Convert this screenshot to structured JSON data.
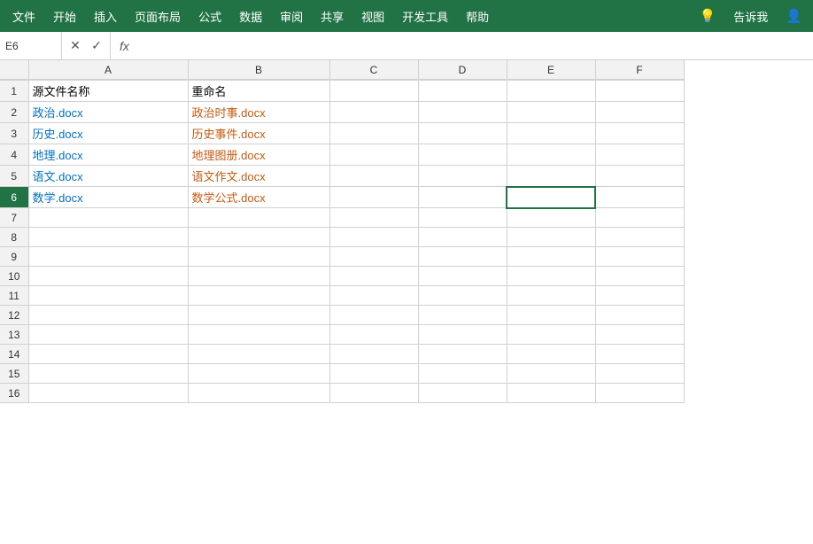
{
  "ribbon": {
    "items": [
      {
        "label": "文件",
        "name": "file"
      },
      {
        "label": "开始",
        "name": "home"
      },
      {
        "label": "插入",
        "name": "insert"
      },
      {
        "label": "页面布局",
        "name": "page-layout"
      },
      {
        "label": "公式",
        "name": "formulas"
      },
      {
        "label": "数据",
        "name": "data"
      },
      {
        "label": "审阅",
        "name": "review"
      },
      {
        "label": "共享",
        "name": "share"
      },
      {
        "label": "视图",
        "name": "view"
      },
      {
        "label": "开发工具",
        "name": "developer"
      },
      {
        "label": "帮助",
        "name": "help"
      }
    ],
    "right_items": [
      {
        "label": "告诉我",
        "name": "tell-me"
      }
    ]
  },
  "formula_bar": {
    "cell_ref": "E6",
    "cancel_label": "✕",
    "confirm_label": "✓",
    "fx_label": "fx"
  },
  "spreadsheet": {
    "col_headers": [
      "A",
      "B",
      "C",
      "D",
      "E",
      "F"
    ],
    "rows": [
      {
        "row_num": "1",
        "cells": [
          {
            "value": "源文件名称",
            "style": "header"
          },
          {
            "value": "重命名",
            "style": "header"
          },
          "",
          "",
          "",
          ""
        ]
      },
      {
        "row_num": "2",
        "cells": [
          {
            "value": "政治.docx",
            "style": "blue"
          },
          {
            "value": "政治时事.docx",
            "style": "orange"
          },
          "",
          "",
          "",
          ""
        ]
      },
      {
        "row_num": "3",
        "cells": [
          {
            "value": "历史.docx",
            "style": "blue"
          },
          {
            "value": "历史事件.docx",
            "style": "orange"
          },
          "",
          "",
          "",
          ""
        ]
      },
      {
        "row_num": "4",
        "cells": [
          {
            "value": "地理.docx",
            "style": "blue"
          },
          {
            "value": "地理图册.docx",
            "style": "orange"
          },
          "",
          "",
          "",
          ""
        ]
      },
      {
        "row_num": "5",
        "cells": [
          {
            "value": "语文.docx",
            "style": "blue"
          },
          {
            "value": "语文作文.docx",
            "style": "orange"
          },
          "",
          "",
          "",
          ""
        ]
      },
      {
        "row_num": "6",
        "cells": [
          {
            "value": "数学.docx",
            "style": "blue"
          },
          {
            "value": "数学公式.docx",
            "style": "orange"
          },
          "",
          "",
          "",
          ""
        ]
      },
      {
        "row_num": "7",
        "cells": [
          "",
          "",
          "",
          "",
          "",
          ""
        ]
      },
      {
        "row_num": "8",
        "cells": [
          "",
          "",
          "",
          "",
          "",
          ""
        ]
      },
      {
        "row_num": "9",
        "cells": [
          "",
          "",
          "",
          "",
          "",
          ""
        ]
      },
      {
        "row_num": "10",
        "cells": [
          "",
          "",
          "",
          "",
          "",
          ""
        ]
      },
      {
        "row_num": "11",
        "cells": [
          "",
          "",
          "",
          "",
          "",
          ""
        ]
      },
      {
        "row_num": "12",
        "cells": [
          "",
          "",
          "",
          "",
          "",
          ""
        ]
      },
      {
        "row_num": "13",
        "cells": [
          "",
          "",
          "",
          "",
          "",
          ""
        ]
      },
      {
        "row_num": "14",
        "cells": [
          "",
          "",
          "",
          "",
          "",
          ""
        ]
      },
      {
        "row_num": "15",
        "cells": [
          "",
          "",
          "",
          "",
          "",
          ""
        ]
      },
      {
        "row_num": "16",
        "cells": [
          "",
          "",
          "",
          "",
          "",
          ""
        ]
      }
    ]
  },
  "colors": {
    "ribbon_bg": "#217346",
    "text_blue": "#0070C0",
    "text_orange": "#C55A11"
  }
}
